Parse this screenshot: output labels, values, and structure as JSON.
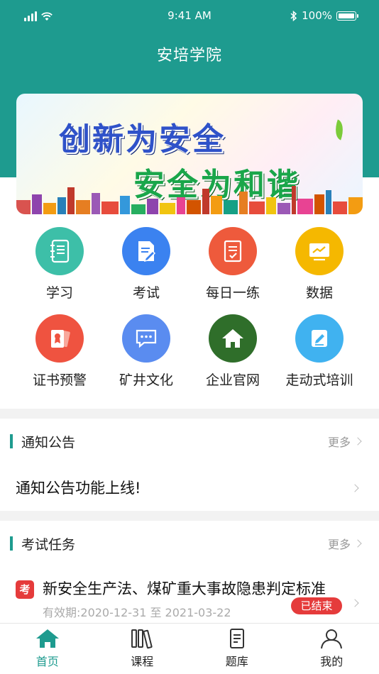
{
  "status_bar": {
    "time": "9:41 AM",
    "battery": "100%"
  },
  "header": {
    "title": "安培学院"
  },
  "banner": {
    "line1": "创新为安全",
    "line2": "安全为和谐"
  },
  "grid": [
    {
      "label": "学习",
      "icon": "notebook-icon",
      "color": "#3dbfa8"
    },
    {
      "label": "考试",
      "icon": "exam-paper-icon",
      "color": "#3b82f0"
    },
    {
      "label": "每日一练",
      "icon": "daily-practice-icon",
      "color": "#ee5a3c"
    },
    {
      "label": "数据",
      "icon": "chart-monitor-icon",
      "color": "#f5b800"
    },
    {
      "label": "证书预警",
      "icon": "certificate-icon",
      "color": "#ef5340"
    },
    {
      "label": "矿井文化",
      "icon": "chat-bubble-icon",
      "color": "#5a8cf0"
    },
    {
      "label": "企业官网",
      "icon": "home-icon",
      "color": "#2f6e2a"
    },
    {
      "label": "走动式培训",
      "icon": "edit-card-icon",
      "color": "#40b2f0"
    }
  ],
  "notice": {
    "title": "通知公告",
    "more": "更多",
    "item": "通知公告功能上线!"
  },
  "exam": {
    "title": "考试任务",
    "more": "更多",
    "badge": "考",
    "item_title": "新安全生产法、煤矿重大事故隐患判定标准",
    "item_date": "有效期:2020-12-31 至 2021-03-22",
    "status": "已结束"
  },
  "tabs": [
    {
      "label": "首页",
      "icon": "home-tab-icon",
      "active": true
    },
    {
      "label": "课程",
      "icon": "books-icon",
      "active": false
    },
    {
      "label": "题库",
      "icon": "document-icon",
      "active": false
    },
    {
      "label": "我的",
      "icon": "user-icon",
      "active": false
    }
  ],
  "colors": {
    "primary": "#1e9b8f",
    "danger": "#e53b3b"
  }
}
